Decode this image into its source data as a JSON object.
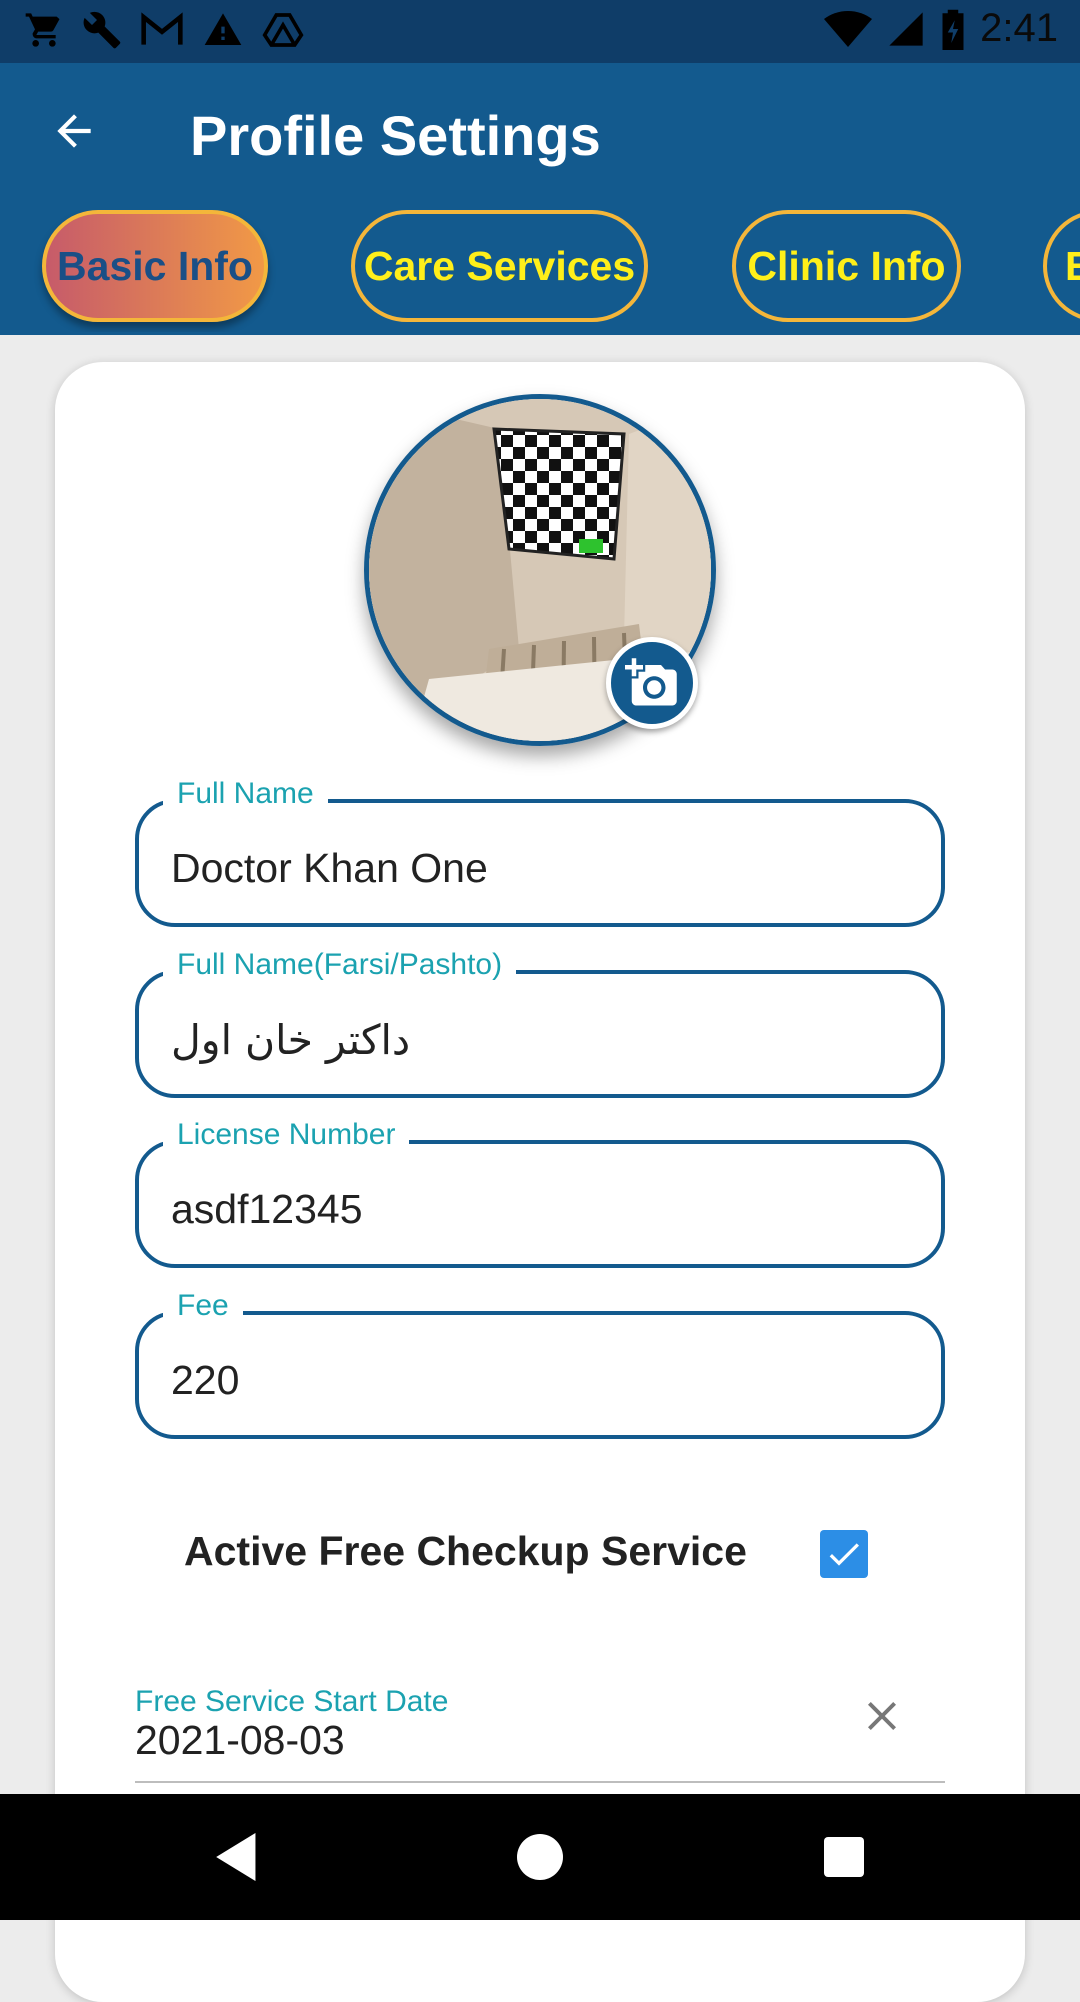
{
  "status_bar": {
    "time": "2:41",
    "left_icons": [
      "cart-icon",
      "wrench-icon",
      "gmail-icon",
      "warning-icon",
      "drive-icon"
    ],
    "right_icons": [
      "wifi-icon",
      "signal-icon",
      "battery-icon"
    ]
  },
  "header": {
    "title": "Profile Settings",
    "back_icon": "back-arrow-icon"
  },
  "tabs": [
    {
      "label": "Basic Info",
      "active": true
    },
    {
      "label": "Care Services",
      "active": false
    },
    {
      "label": "Clinic Info",
      "active": false
    },
    {
      "label": "E",
      "active": false
    }
  ],
  "profile": {
    "avatar_icon": "profile-photo",
    "camera_icon": "add-photo-icon"
  },
  "fields": {
    "full_name": {
      "label": "Full Name",
      "value": "Doctor Khan One"
    },
    "full_name_local": {
      "label": "Full Name(Farsi/Pashto)",
      "value": "داکتر خان اول"
    },
    "license_number": {
      "label": "License Number",
      "value": "asdf12345"
    },
    "fee": {
      "label": "Fee",
      "value": "220"
    }
  },
  "free_checkup": {
    "label": "Active Free Checkup Service",
    "checked": true
  },
  "free_service_start": {
    "label": "Free Service Start Date",
    "value": "2021-08-03",
    "clear_icon": "close-icon"
  },
  "colors": {
    "app_bar": "#135a8e",
    "status_bar": "#0f3d68",
    "tab_border": "#f4b63a",
    "tab_text": "#ffef1a",
    "label_teal": "#1ba2b0",
    "checkbox": "#2c8ee6"
  }
}
